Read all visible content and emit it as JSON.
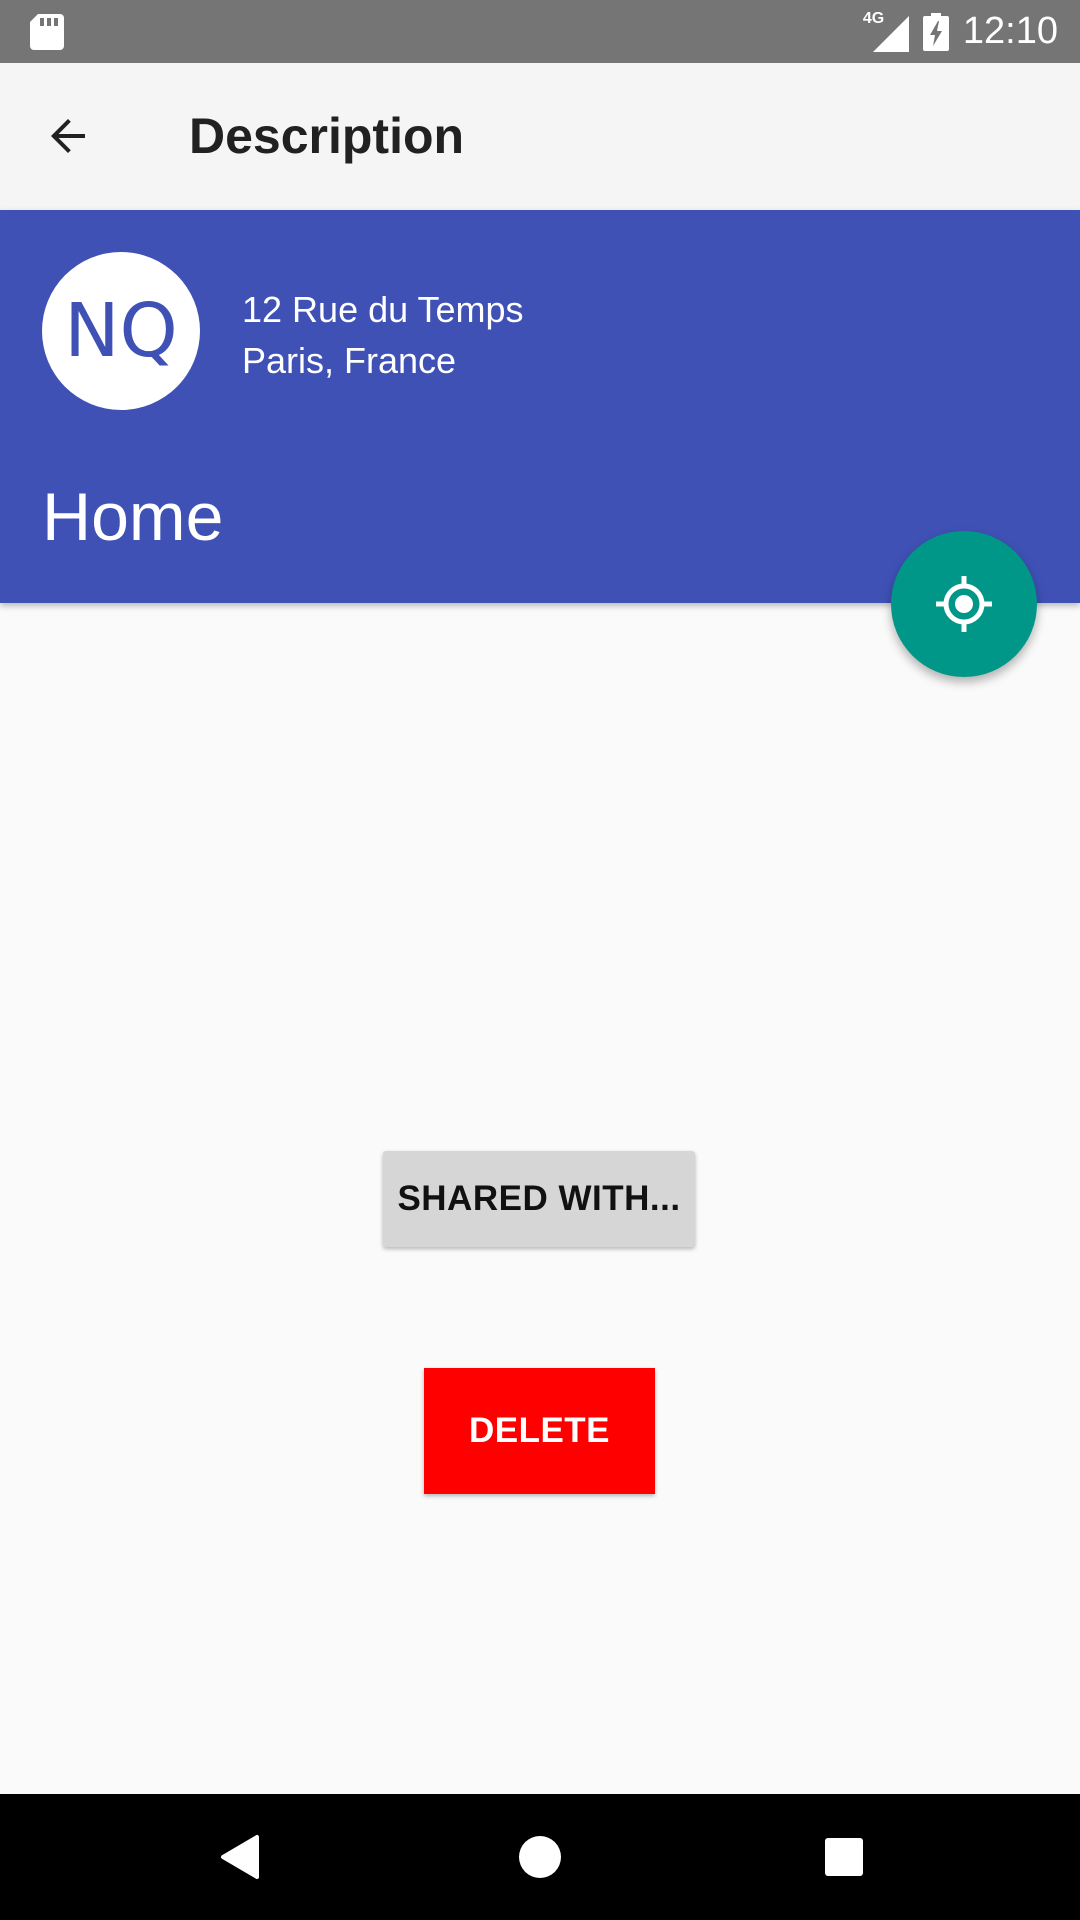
{
  "status_bar": {
    "network_type": "4G",
    "time": "12:10",
    "icons": [
      "sd-card-icon",
      "signal-icon",
      "battery-charging-icon"
    ]
  },
  "toolbar": {
    "title": "Description",
    "back_icon": "arrow-back-icon"
  },
  "header": {
    "avatar_initials": "NQ",
    "address_line1": "12 Rue du Temps",
    "address_line2": "Paris, France",
    "place_name": "Home",
    "background_color": "#3f51b5"
  },
  "fab": {
    "icon": "my-location-icon",
    "color": "#009688"
  },
  "actions": {
    "shared_label": "SHARED WITH...",
    "delete_label": "DELETE",
    "delete_color": "#ff0000"
  },
  "nav_bar": {
    "icons": [
      "nav-back-icon",
      "nav-home-icon",
      "nav-recents-icon"
    ]
  }
}
